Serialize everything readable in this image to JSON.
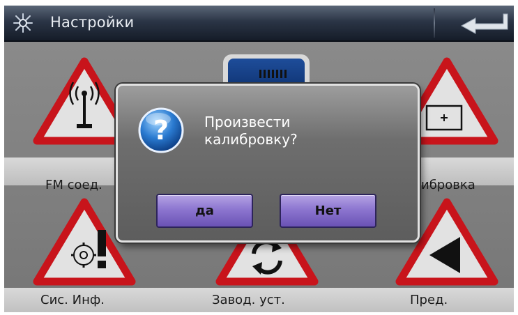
{
  "header": {
    "title": "Настройки",
    "icon": "gear-sparkle-icon",
    "back_icon": "return-arrow-icon"
  },
  "tiles": [
    {
      "label": "FM соед.",
      "icon": "antenna-icon"
    },
    {
      "label": "",
      "icon": "tuner-icon"
    },
    {
      "label": "ибровка",
      "icon": "calibration-icon"
    },
    {
      "label": "Сис. Инф.",
      "icon": "system-info-icon"
    },
    {
      "label": "Завод. уст.",
      "icon": "factory-reset-icon"
    },
    {
      "label": "Пред.",
      "icon": "previous-icon"
    }
  ],
  "dialog": {
    "icon": "question-icon",
    "message_line1": "Произвести",
    "message_line2": "калибровку?",
    "yes_label": "да",
    "no_label": "Нет"
  },
  "colors": {
    "warning_red": "#c8141b",
    "button_purple": "#8d76d0",
    "title_bar": "#2b3546"
  }
}
